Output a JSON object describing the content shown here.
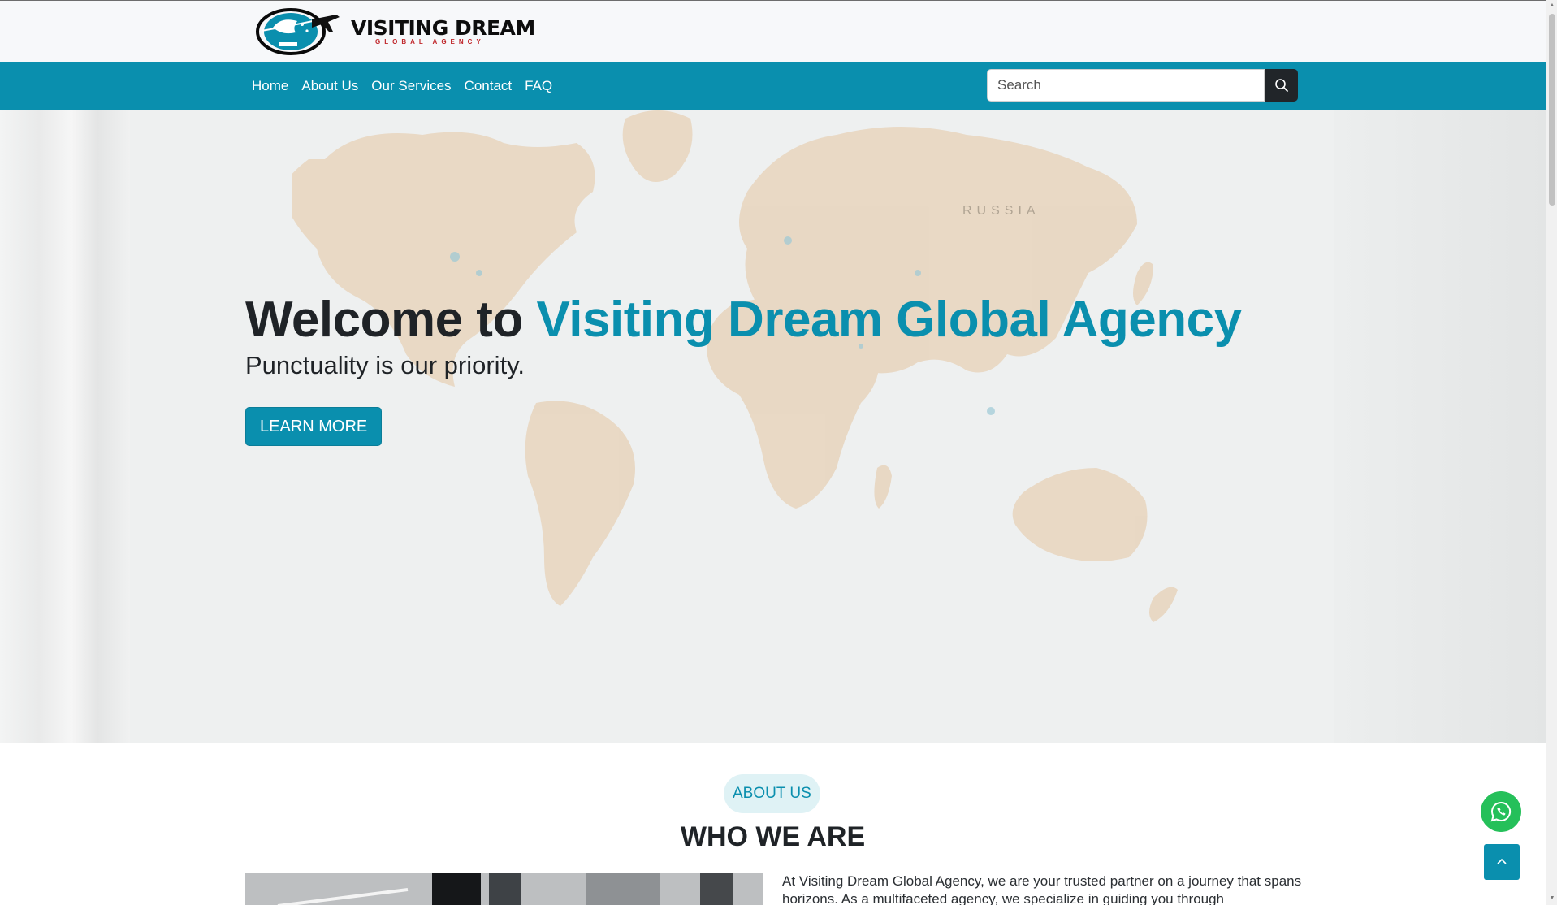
{
  "brand": {
    "name": "VISITING DREAM",
    "tagline": "GLOBAL AGENCY",
    "accent_color": "#0a8fae",
    "logo_icon": "globe-airplane-logo"
  },
  "nav": {
    "items": [
      {
        "label": "Home"
      },
      {
        "label": "About Us"
      },
      {
        "label": "Our Services"
      },
      {
        "label": "Contact"
      },
      {
        "label": "FAQ"
      }
    ]
  },
  "search": {
    "placeholder": "Search",
    "icon": "search-icon"
  },
  "hero": {
    "title_prefix": "Welcome to ",
    "title_accent": "Visiting Dream Global Agency",
    "subtitle": "Punctuality is our priority.",
    "button_label": "LEARN MORE",
    "map_label": "RUSSIA"
  },
  "about": {
    "badge": "ABOUT US",
    "title": "WHO WE ARE",
    "text": "At Visiting Dream Global Agency, we are your trusted partner on a journey that spans horizons. As a multifaceted agency, we specialize in guiding you through"
  },
  "floating": {
    "whatsapp_icon": "whatsapp-icon",
    "back_to_top_icon": "chevron-up-icon",
    "whatsapp_color": "#25c05a"
  }
}
